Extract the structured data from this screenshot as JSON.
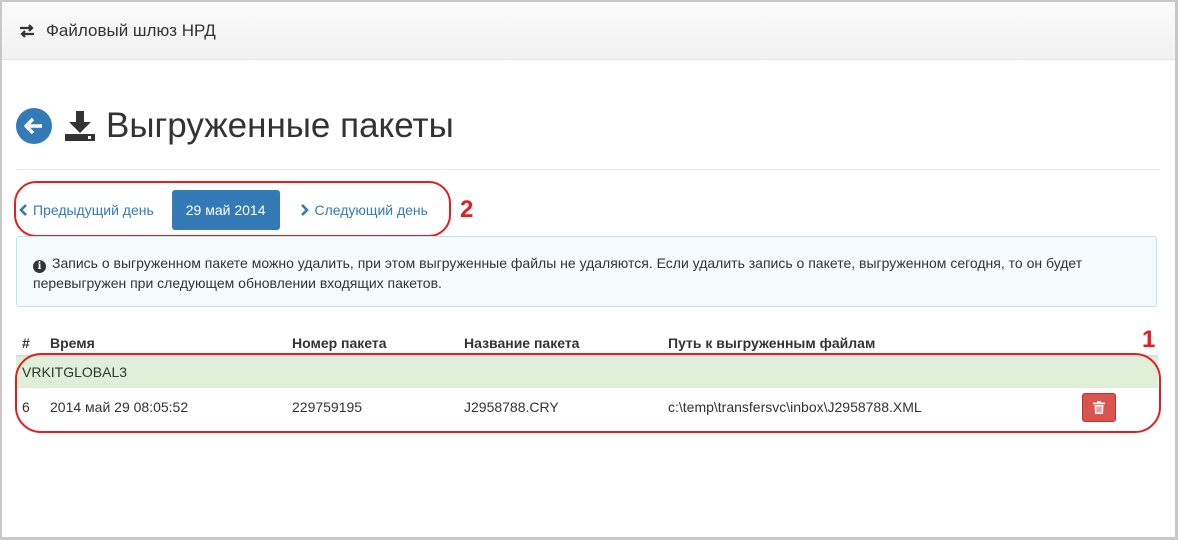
{
  "navbar": {
    "brand": "Файловый шлюз НРД",
    "icon": "exchange-arrows-icon"
  },
  "header": {
    "title": "Выгруженные пакеты",
    "back_icon": "arrow-left-circle-icon",
    "title_icon": "download-icon"
  },
  "pager": {
    "prev_label": "Предыдущий день",
    "current_label": "29 май 2014",
    "next_label": "Следующий день"
  },
  "info": {
    "text": "Запись о выгруженном пакете можно удалить, при этом выгруженные файлы не удаляются. Если удалить запись о пакете, выгруженном сегодня, то он будет перевыгружен при следующем обновлении входящих пакетов."
  },
  "table": {
    "columns": [
      "#",
      "Время",
      "Номер пакета",
      "Название пакета",
      "Путь к выгруженным файлам"
    ],
    "group": "VRKITGLOBAL3",
    "rows": [
      {
        "num": "6",
        "time": "2014 май 29 08:05:52",
        "package_number": "229759195",
        "package_name": "J2958788.CRY",
        "path": "c:\\temp\\transfersvc\\inbox\\J2958788.XML"
      }
    ]
  },
  "annotations": {
    "one": "1",
    "two": "2",
    "color": "#e02020"
  },
  "colors": {
    "primary": "#337ab7",
    "danger": "#d9534f",
    "success_bg": "#dff0d8",
    "info_border": "#bce8f1"
  }
}
